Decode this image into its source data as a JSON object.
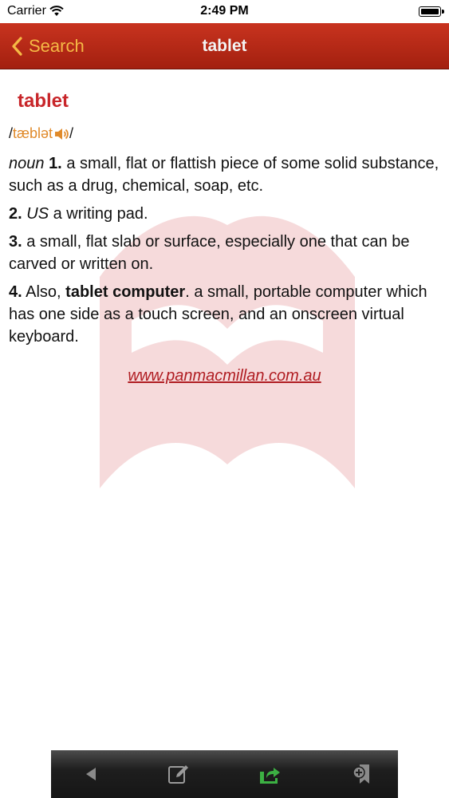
{
  "status_bar": {
    "carrier": "Carrier",
    "time": "2:49 PM"
  },
  "nav": {
    "back_label": "Search",
    "title": "tablet"
  },
  "entry": {
    "headword": "tablet",
    "pron_open": "/",
    "pron_ipa": "tæblət",
    "pron_close": "/",
    "defs": {
      "d1_pos": "noun",
      "d1_num": "1.",
      "d1_text": "a small, flat or flattish piece of some solid substance, such as a drug, chemical, soap, etc.",
      "d2_num": "2.",
      "d2_label": "US",
      "d2_text": "a writing pad.",
      "d3_num": "3.",
      "d3_text": "a small, flat slab or surface, especially one that can be carved or written on.",
      "d4_num": "4.",
      "d4_pre": "Also,",
      "d4_bold": "tablet computer",
      "d4_text": ". a small, portable computer which has one side as a touch screen, and an onscreen virtual keyboard."
    },
    "link": "www.panmacmillan.com.au"
  },
  "colors": {
    "nav_bar": "#b52a17",
    "back_accent": "#f5b945",
    "headword": "#c8262a",
    "pronunciation": "#e08a2a",
    "link": "#b01d22",
    "share_icon": "#3cb043"
  },
  "icons": {
    "status": [
      "wifi-icon",
      "battery-icon"
    ],
    "nav": [
      "chevron-left-icon"
    ],
    "pronunciation": "speaker-icon",
    "toolbar": [
      "triangle-left-icon",
      "edit-note-icon",
      "share-arrow-icon",
      "bookmark-add-icon"
    ]
  }
}
